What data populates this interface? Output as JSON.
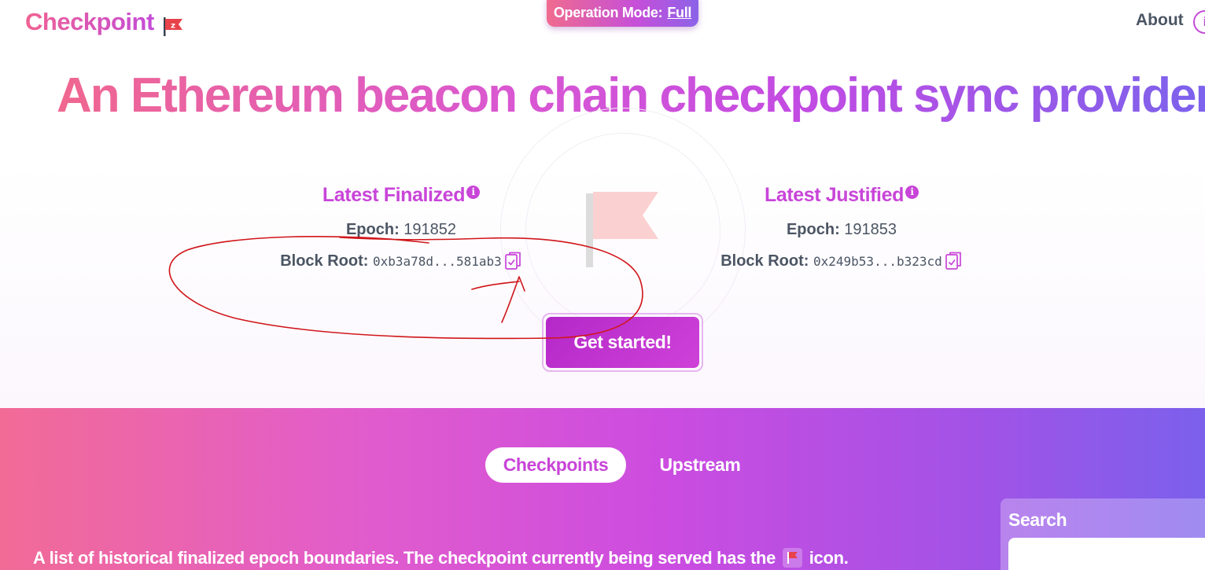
{
  "header": {
    "logo_text": "Checkpoint",
    "logo_badge": "z",
    "operation_mode_label": "Operation Mode:",
    "operation_mode_value": "Full",
    "about_label": "About",
    "about_icon_glyph": "i"
  },
  "hero": {
    "title": "An Ethereum beacon chain checkpoint sync provider"
  },
  "finalized": {
    "title": "Latest Finalized",
    "epoch_label": "Epoch:",
    "epoch_value": "191852",
    "block_root_label": "Block Root:",
    "block_root_value": "0xb3a78d...581ab3"
  },
  "justified": {
    "title": "Latest Justified",
    "epoch_label": "Epoch:",
    "epoch_value": "191853",
    "block_root_label": "Block Root:",
    "block_root_value": "0x249b53...b323cd"
  },
  "cta": {
    "label": "Get started!"
  },
  "tabs": [
    {
      "label": "Checkpoints",
      "active": true
    },
    {
      "label": "Upstream",
      "active": false
    }
  ],
  "search": {
    "label": "Search",
    "value": ""
  },
  "description": {
    "before": "A list of historical finalized epoch boundaries. The checkpoint currently being served has the",
    "after": "icon."
  },
  "icons": {
    "logo_flag": "flag-icon",
    "info": "info-icon",
    "copy": "clipboard-check-icon",
    "hero_flag": "flag-icon"
  },
  "colors": {
    "accent": "#c845d8",
    "brand_pink": "#f06292",
    "brand_violet": "#7b60ec",
    "flag_red": "#e8424b",
    "annotation_red": "#d0161a"
  }
}
